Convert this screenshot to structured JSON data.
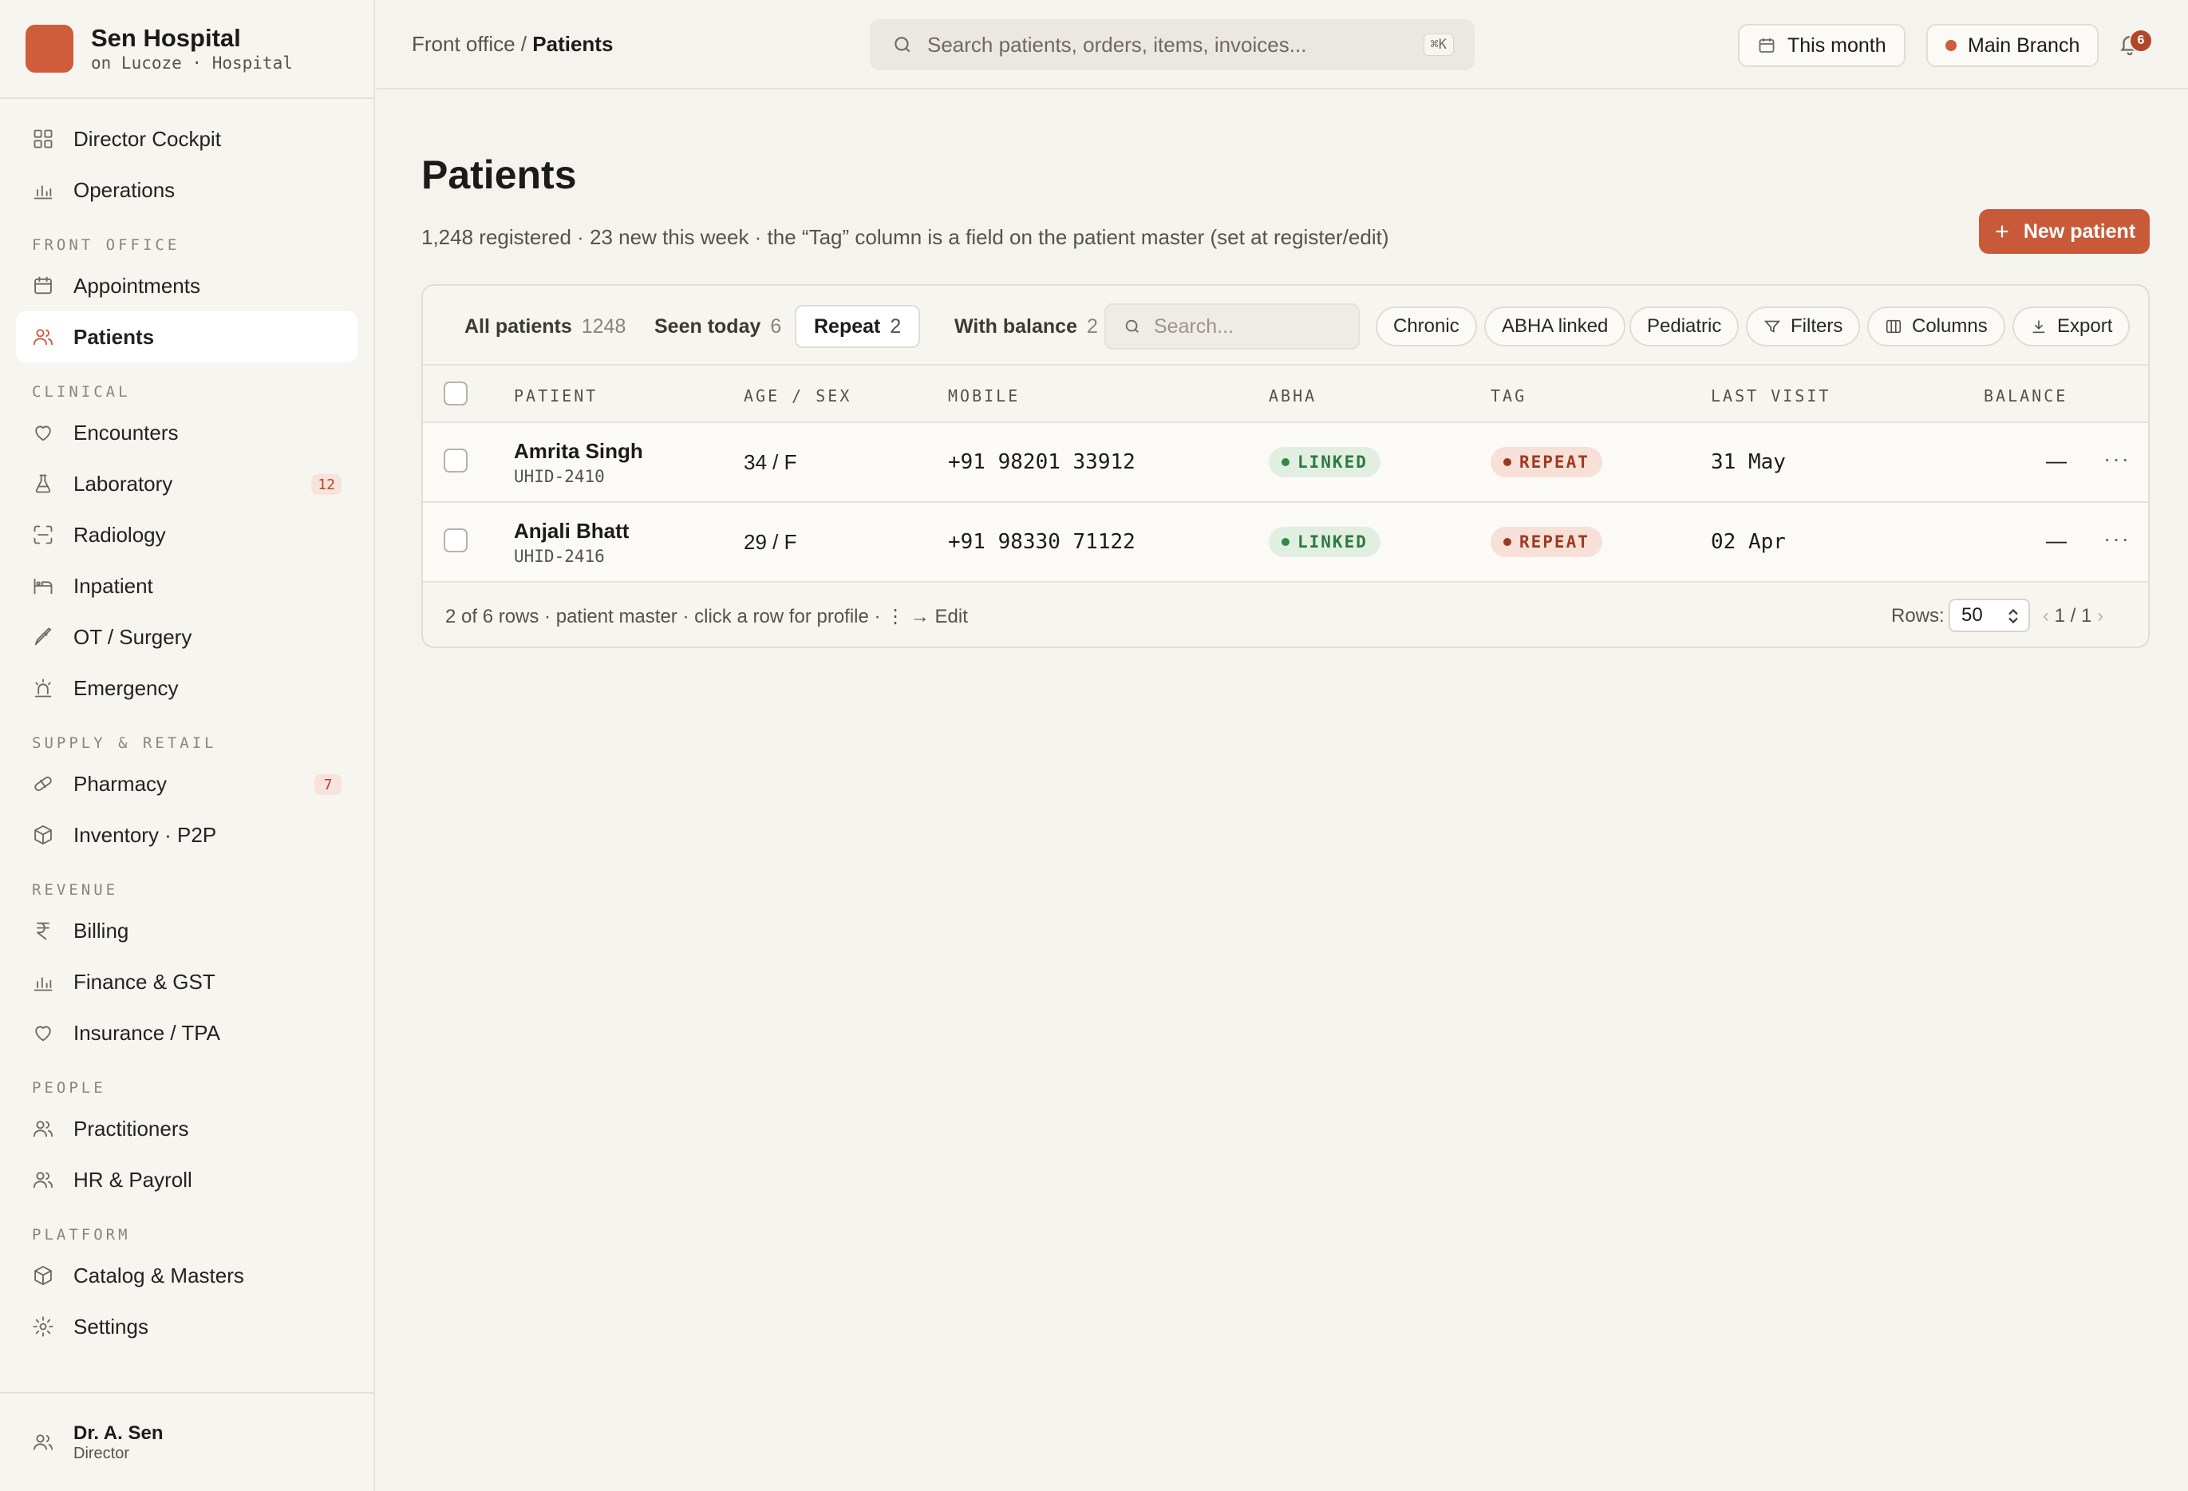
{
  "brand": {
    "name": "Sen Hospital",
    "subtitle": "on Lucoze · Hospital"
  },
  "sidebar": {
    "top_items": [
      {
        "label": "Director Cockpit",
        "icon": "grid-icon"
      },
      {
        "label": "Operations",
        "icon": "bar-chart-icon"
      }
    ],
    "sections": [
      {
        "title": "FRONT OFFICE",
        "items": [
          {
            "label": "Appointments",
            "icon": "calendar-icon"
          },
          {
            "label": "Patients",
            "icon": "users-icon",
            "active": true
          }
        ]
      },
      {
        "title": "CLINICAL",
        "items": [
          {
            "label": "Encounters",
            "icon": "heart-icon"
          },
          {
            "label": "Laboratory",
            "icon": "flask-icon",
            "badge": "12"
          },
          {
            "label": "Radiology",
            "icon": "scan-icon"
          },
          {
            "label": "Inpatient",
            "icon": "bed-icon"
          },
          {
            "label": "OT / Surgery",
            "icon": "scalpel-icon"
          },
          {
            "label": "Emergency",
            "icon": "siren-icon"
          }
        ]
      },
      {
        "title": "SUPPLY & RETAIL",
        "items": [
          {
            "label": "Pharmacy",
            "icon": "pill-icon",
            "badge": "7"
          },
          {
            "label": "Inventory · P2P",
            "icon": "box-icon"
          }
        ]
      },
      {
        "title": "REVENUE",
        "items": [
          {
            "label": "Billing",
            "icon": "rupee-icon"
          },
          {
            "label": "Finance & GST",
            "icon": "bar-chart-icon"
          },
          {
            "label": "Insurance / TPA",
            "icon": "heart-icon"
          }
        ]
      },
      {
        "title": "PEOPLE",
        "items": [
          {
            "label": "Practitioners",
            "icon": "users-icon"
          },
          {
            "label": "HR & Payroll",
            "icon": "users-icon"
          }
        ]
      },
      {
        "title": "PLATFORM",
        "items": [
          {
            "label": "Catalog & Masters",
            "icon": "box-icon"
          },
          {
            "label": "Settings",
            "icon": "gear-icon"
          }
        ]
      }
    ],
    "user": {
      "name": "Dr. A. Sen",
      "role": "Director"
    }
  },
  "topbar": {
    "crumb_parent": "Front office /",
    "crumb_current": "Patients",
    "search_placeholder": "Search patients, orders, items, invoices...",
    "search_shortcut": "⌘K",
    "period_label": "This month",
    "branch_label": "Main Branch",
    "notification_count": "6"
  },
  "page": {
    "title": "Patients",
    "subtitle": "1,248 registered · 23 new this week · the “Tag” column is a field on the patient master (set at register/edit)",
    "new_button": "New patient"
  },
  "tabs": [
    {
      "label": "All patients",
      "count": "1248"
    },
    {
      "label": "Seen today",
      "count": "6"
    },
    {
      "label": "Repeat",
      "count": "2",
      "active": true
    },
    {
      "label": "With balance",
      "count": "2"
    }
  ],
  "table_search_placeholder": "Search...",
  "chips": [
    "Chronic",
    "ABHA linked",
    "Pediatric"
  ],
  "actions": {
    "filters": "Filters",
    "columns": "Columns",
    "export": "Export"
  },
  "columns": {
    "patient": "PATIENT",
    "age_sex": "AGE / SEX",
    "mobile": "MOBILE",
    "abha": "ABHA",
    "tag": "TAG",
    "last_visit": "LAST VISIT",
    "balance": "BALANCE"
  },
  "rows": [
    {
      "name": "Amrita Singh",
      "uhid": "UHID-2410",
      "age_sex": "34 / F",
      "mobile": "+91 98201 33912",
      "abha": "LINKED",
      "tag": "REPEAT",
      "last_visit": "31 May",
      "balance": "—"
    },
    {
      "name": "Anjali Bhatt",
      "uhid": "UHID-2416",
      "age_sex": "29 / F",
      "mobile": "+91 98330 71122",
      "abha": "LINKED",
      "tag": "REPEAT",
      "last_visit": "02 Apr",
      "balance": "—"
    }
  ],
  "footer": {
    "summary": "2 of 6 rows · patient master · click a row for profile · ⋮ → Edit",
    "rows_label": "Rows:",
    "rows_value": "50",
    "page_current": "1",
    "page_sep": "/",
    "page_total": "1"
  },
  "colors": {
    "accent": "#c95a39",
    "linked": "#2f7a3f",
    "repeat": "#9b3a22"
  }
}
